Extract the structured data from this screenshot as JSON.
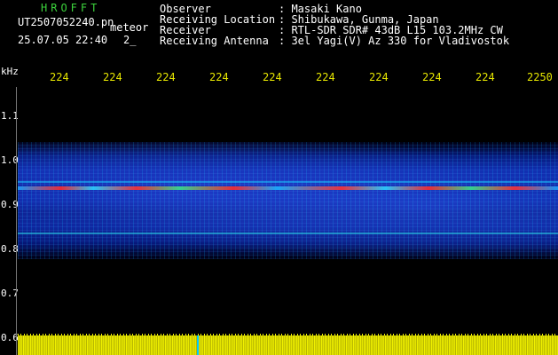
{
  "header": {
    "brand": "HROFFT",
    "filename": "UT2507052240.pn",
    "mode": "meteor",
    "datetime": "25.07.05 22:40",
    "page_marker": "2_",
    "meta": {
      "observer_label": "Observer",
      "observer_value": ": Masaki Kano",
      "location_label": "Receiving Location",
      "location_value": ": Shibukawa, Gunma, Japan",
      "receiver_label": "Receiver",
      "receiver_value": ": RTL-SDR SDR# 43dB L15 103.2MHz CW",
      "antenna_label": "Receiving Antenna",
      "antenna_value": ": 3el Yagi(V) Az 330 for Vladivostok"
    }
  },
  "axes": {
    "y_unit": "kHz",
    "y_ticks": [
      "1.1",
      "1.0",
      "0.9",
      "0.8",
      "0.7",
      "0.6"
    ],
    "x_ticks": [
      "224",
      "224",
      "224",
      "224",
      "224",
      "224",
      "224",
      "224",
      "224",
      "2250"
    ]
  },
  "colors": {
    "brand": "#3cd23c",
    "x_tick": "#e6e600",
    "floor": "#e6e600",
    "band": "#0d2aa8",
    "meteor_line": "#ff2a2a"
  }
}
